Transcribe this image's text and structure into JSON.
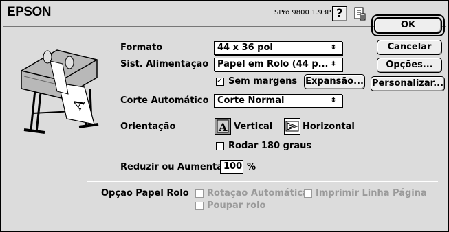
{
  "header": {
    "brand": "EPSON",
    "version": "SPro 9800 1.93P",
    "help_icon": "question-mark-icon",
    "info_icon": "document-info-icon"
  },
  "buttons": {
    "ok": "OK",
    "cancel": "Cancelar",
    "options": "Opções...",
    "customize": "Personalizar...",
    "expansion": "Expansão..."
  },
  "form": {
    "format_label": "Formato",
    "format_value": "44 x 36 pol",
    "feed_label": "Sist. Alimentação",
    "feed_value": "Papel em Rolo (44 p...",
    "borderless_label": "Sem margens",
    "borderless_checked": true,
    "cut_label": "Corte Automático",
    "cut_value": "Corte Normal",
    "orientation_label": "Orientação",
    "vertical_label": "Vertical",
    "horizontal_label": "Horizontal",
    "orientation_selected": "Vertical",
    "rotate_label": "Rodar 180 graus",
    "rotate_checked": false,
    "scale_label": "Reduzir ou Aumentar",
    "scale_value": "100",
    "scale_unit": "%"
  },
  "roll_options": {
    "title": "Opção Papel Rolo",
    "auto_rotate": "Rotação Automática",
    "print_page_line": "Imprimir Linha Página",
    "save_roll": "Poupar rolo"
  }
}
